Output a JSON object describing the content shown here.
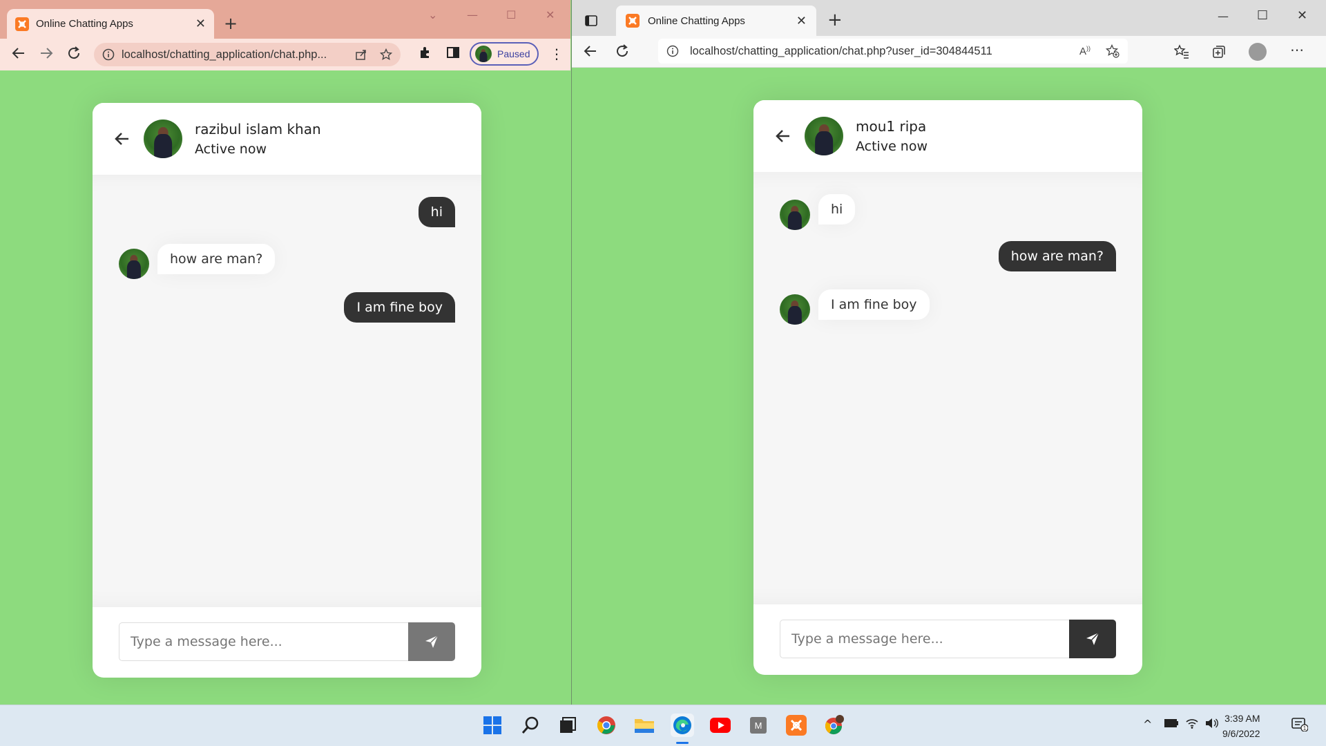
{
  "left_browser": {
    "tab_title": "Online Chatting Apps",
    "url": "localhost/chatting_application/chat.php...",
    "profile_label": "Paused"
  },
  "right_browser": {
    "tab_title": "Online Chatting Apps",
    "url": "localhost/chatting_application/chat.php?user_id=304844511"
  },
  "left_chat": {
    "name": "razibul islam khan",
    "status": "Active now",
    "messages": [
      {
        "dir": "out",
        "text": "hi"
      },
      {
        "dir": "in",
        "text": "how are man?"
      },
      {
        "dir": "out",
        "text": "I am fine boy"
      }
    ],
    "input_placeholder": "Type a message here..."
  },
  "right_chat": {
    "name": "mou1 ripa",
    "status": "Active now",
    "messages": [
      {
        "dir": "in",
        "text": "hi"
      },
      {
        "dir": "out",
        "text": "how are man?"
      },
      {
        "dir": "in",
        "text": "I am fine boy"
      }
    ],
    "input_placeholder": "Type a message here..."
  },
  "taskbar": {
    "time": "3:39 AM",
    "date": "9/6/2022",
    "apps": [
      "windows-start",
      "search",
      "task-view",
      "chrome",
      "file-explorer",
      "edge",
      "youtube",
      "m-app",
      "xampp",
      "chrome-profile"
    ]
  },
  "colors": {
    "page_bg": "#8ddb7e",
    "bubble_out": "#333333",
    "send_disabled": "#777777",
    "send_active": "#333333",
    "xampp_orange": "#fb7a24"
  }
}
